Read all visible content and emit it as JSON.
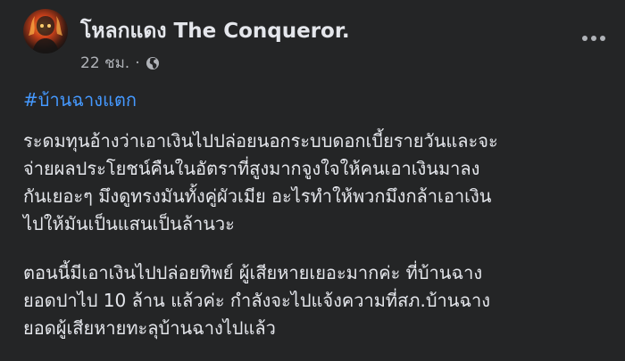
{
  "post": {
    "author": "โหลกแดง The Conqueror.",
    "timestamp": "22 ชม.",
    "separator": "·",
    "privacy_icon": "globe-icon",
    "more_icon": "more-options-icon",
    "hashtag": "#บ้านฉางแตก",
    "paragraph1": [
      "ระดมทุนอ้างว่าเอาเงินไปปล่อยนอกระบบดอกเบี้ยรายวันและจะ",
      "จ่ายผลประโยชน์คืนในอัตราที่สูงมากจูงใจให้คนเอาเงินมาลง",
      "กันเยอะๆ มึงดูทรงมันทั้งคู่ผัวเมีย อะไรทำให้พวกมึงกล้าเอาเงิน",
      "ไปให้มันเป็นแสนเป็นล้านวะ"
    ],
    "paragraph2": [
      "ตอนนี้มีเอาเงินไปปล่อยทิพย์ ผู้เสียหายเยอะมากค่ะ ที่บ้านฉาง",
      "ยอดปาไป 10 ล้าน แล้วค่ะ กำลังจะไปแจ้งความที่สภ.บ้านฉาง",
      "ยอดผู้เสียหายทะลุบ้านฉางไปแล้ว"
    ]
  },
  "colors": {
    "background": "#242526",
    "primary_text": "#e4e6eb",
    "secondary_text": "#b0b3b8",
    "link": "#4599ff"
  }
}
